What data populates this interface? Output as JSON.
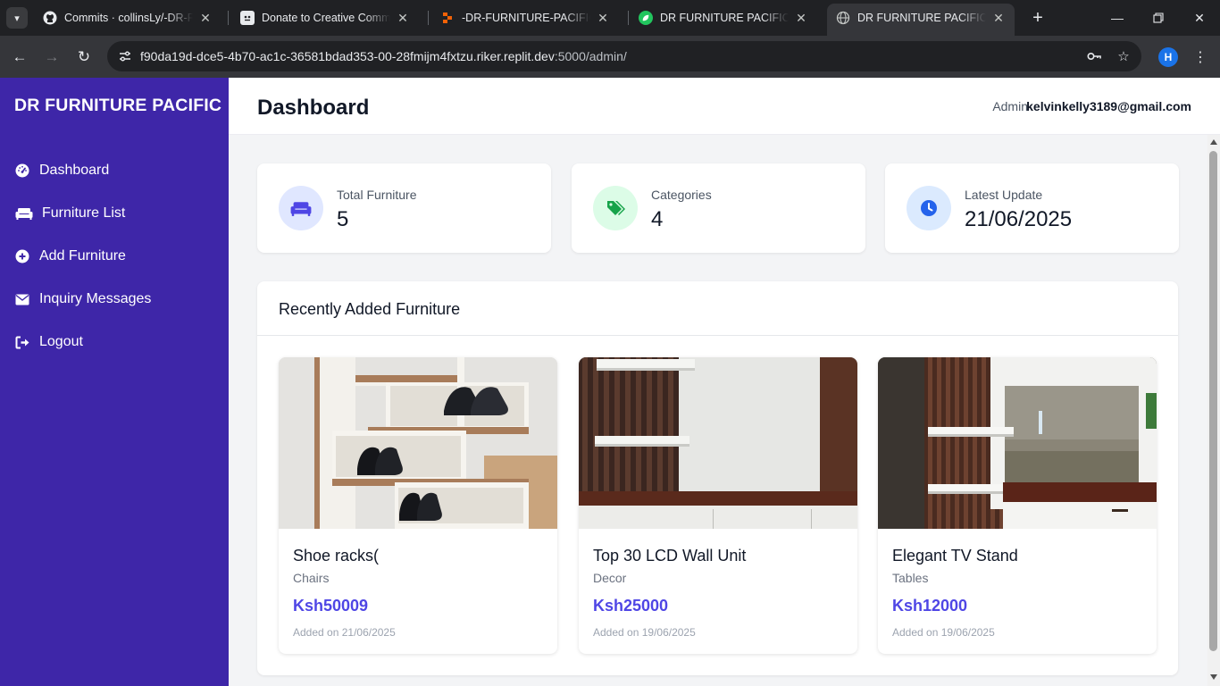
{
  "browser": {
    "tabs": [
      {
        "title": "Commits · collinsLy/-DR-FURNITURE-PACIFIC",
        "icon": "github-icon"
      },
      {
        "title": "Donate to Creative Commons",
        "icon": "creative-commons-icon"
      },
      {
        "title": "-DR-FURNITURE-PACIFIC - Replit",
        "icon": "replit-icon"
      },
      {
        "title": "DR FURNITURE PACIFIC - Quality Furniture",
        "icon": "leaf-icon"
      },
      {
        "title": "DR FURNITURE PACIFIC - Admin",
        "icon": "globe-icon"
      }
    ],
    "active_tab": 4,
    "url_main": "f90da19d-dce5-4b70-ac1c-36581bdad353-00-28fmijm4fxtzu.riker.replit.dev",
    "url_rest": ":5000/admin/",
    "profile_initial": "H"
  },
  "sidebar": {
    "brand": "DR FURNITURE PACIFIC",
    "items": [
      {
        "label": "Dashboard",
        "icon": "gauge-icon"
      },
      {
        "label": "Furniture List",
        "icon": "couch-icon"
      },
      {
        "label": "Add Furniture",
        "icon": "plus-circle-icon"
      },
      {
        "label": "Inquiry Messages",
        "icon": "envelope-icon"
      },
      {
        "label": "Logout",
        "icon": "logout-icon"
      }
    ]
  },
  "header": {
    "title": "Dashboard",
    "admin_label": "Admin",
    "admin_email": "kelvinkelly3189@gmail.com"
  },
  "stats": [
    {
      "label": "Total Furniture",
      "value": "5",
      "icon": "couch-icon",
      "color": "#4f46e5",
      "bg": "#e0e7ff"
    },
    {
      "label": "Categories",
      "value": "4",
      "icon": "tags-icon",
      "color": "#16a34a",
      "bg": "#dcfce7"
    },
    {
      "label": "Latest Update",
      "value": "21/06/2025",
      "icon": "clock-icon",
      "color": "#2563eb",
      "bg": "#dbeafe"
    }
  ],
  "recent": {
    "title": "Recently Added Furniture",
    "items": [
      {
        "name": "Shoe racks(",
        "category": "Chairs",
        "price": "Ksh50009",
        "added": "Added on 21/06/2025"
      },
      {
        "name": "Top 30 LCD Wall Unit",
        "category": "Decor",
        "price": "Ksh25000",
        "added": "Added on 19/06/2025"
      },
      {
        "name": "Elegant TV Stand",
        "category": "Tables",
        "price": "Ksh12000",
        "added": "Added on 19/06/2025"
      }
    ]
  },
  "colors": {
    "sidebar": "#3e26a8",
    "accent": "#4f46e5"
  }
}
